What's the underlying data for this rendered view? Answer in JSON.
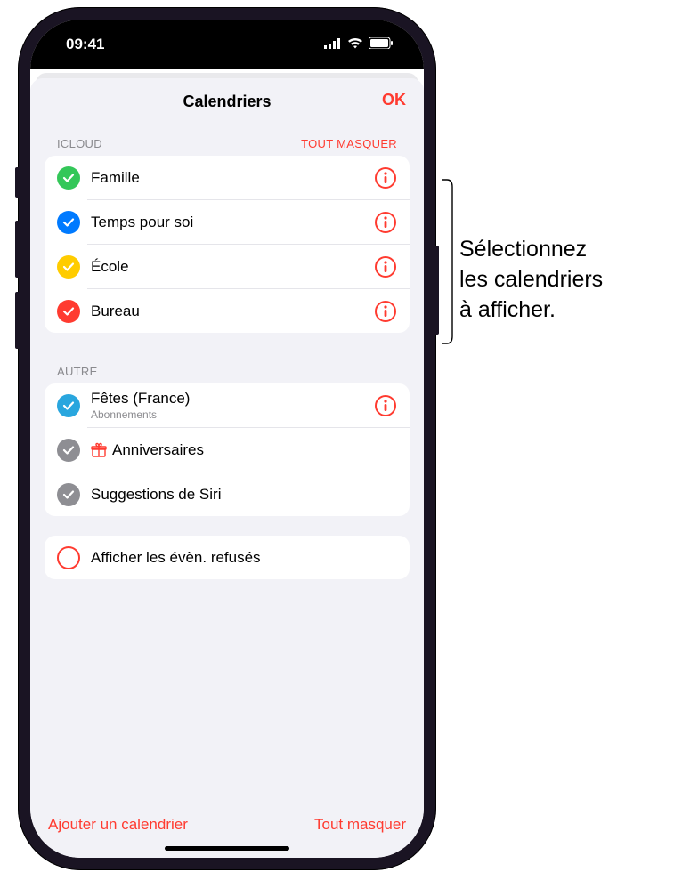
{
  "status": {
    "time": "09:41"
  },
  "sheet": {
    "title": "Calendriers",
    "ok": "OK"
  },
  "sections": {
    "icloud": {
      "label": "ICLOUD",
      "action": "TOUT MASQUER",
      "items": [
        {
          "label": "Famille",
          "color": "#34c759"
        },
        {
          "label": "Temps pour soi",
          "color": "#007aff"
        },
        {
          "label": "École",
          "color": "#ffcc00"
        },
        {
          "label": "Bureau",
          "color": "#ff3b30"
        }
      ]
    },
    "other": {
      "label": "AUTRE",
      "items": [
        {
          "label": "Fêtes (France)",
          "sub": "Abonnements",
          "color": "#29a6de",
          "info": true
        },
        {
          "label": "Anniversaires",
          "color": "#8e8e93",
          "gift": true
        },
        {
          "label": "Suggestions de Siri",
          "color": "#8e8e93"
        }
      ]
    },
    "declined": {
      "label": "Afficher les évèn. refusés"
    }
  },
  "footer": {
    "add": "Ajouter un calendrier",
    "hideAll": "Tout masquer"
  },
  "annotation": {
    "line1": "Sélectionnez",
    "line2": "les calendriers",
    "line3": "à afficher."
  }
}
